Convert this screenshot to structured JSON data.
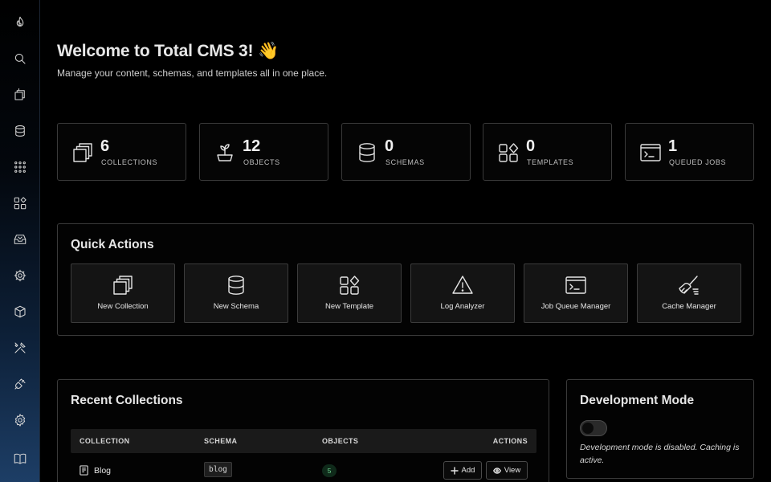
{
  "page": {
    "title": "Welcome to Total CMS 3! 👋",
    "subtitle": "Manage your content, schemas, and templates all in one place."
  },
  "sidebar": {
    "items": [
      {
        "name": "dashboard",
        "icon": "flame-icon"
      },
      {
        "name": "search",
        "icon": "search-icon"
      },
      {
        "name": "collections",
        "icon": "collections-icon"
      },
      {
        "name": "schemas",
        "icon": "database-icon"
      },
      {
        "name": "objects",
        "icon": "grid-dots-icon"
      },
      {
        "name": "templates",
        "icon": "templates-icon"
      },
      {
        "name": "inbox",
        "icon": "inbox-icon"
      },
      {
        "name": "jobs",
        "icon": "cog-chip-icon"
      },
      {
        "name": "packages",
        "icon": "box-icon"
      },
      {
        "name": "tools",
        "icon": "tools-icon"
      },
      {
        "name": "integrations",
        "icon": "plug-icon"
      },
      {
        "name": "settings",
        "icon": "gear-icon"
      },
      {
        "name": "docs",
        "icon": "book-icon"
      }
    ]
  },
  "stats": [
    {
      "value": "6",
      "label": "COLLECTIONS",
      "icon": "collections-icon"
    },
    {
      "value": "12",
      "label": "OBJECTS",
      "icon": "plant-icon"
    },
    {
      "value": "0",
      "label": "SCHEMAS",
      "icon": "database-icon"
    },
    {
      "value": "0",
      "label": "TEMPLATES",
      "icon": "templates-icon"
    },
    {
      "value": "1",
      "label": "QUEUED JOBS",
      "icon": "terminal-icon"
    }
  ],
  "quick_actions": {
    "title": "Quick Actions",
    "items": [
      {
        "label": "New Collection",
        "icon": "collections-icon"
      },
      {
        "label": "New Schema",
        "icon": "database-icon"
      },
      {
        "label": "New Template",
        "icon": "templates-icon"
      },
      {
        "label": "Log Analyzer",
        "icon": "warning-icon"
      },
      {
        "label": "Job Queue Manager",
        "icon": "terminal-icon"
      },
      {
        "label": "Cache Manager",
        "icon": "broom-icon"
      }
    ]
  },
  "recent_collections": {
    "title": "Recent Collections",
    "columns": [
      "COLLECTION",
      "SCHEMA",
      "OBJECTS",
      "ACTIONS"
    ],
    "rows": [
      {
        "name": "Blog",
        "schema": "blog",
        "objects": "5",
        "add_label": "Add",
        "view_label": "View"
      }
    ]
  },
  "dev_mode": {
    "title": "Development Mode",
    "enabled": false,
    "description": "Development mode is disabled. Caching is active."
  },
  "colors": {
    "background": "#000000",
    "panel_border": "#3a3a3a",
    "badge_green": "#6fd38f"
  }
}
